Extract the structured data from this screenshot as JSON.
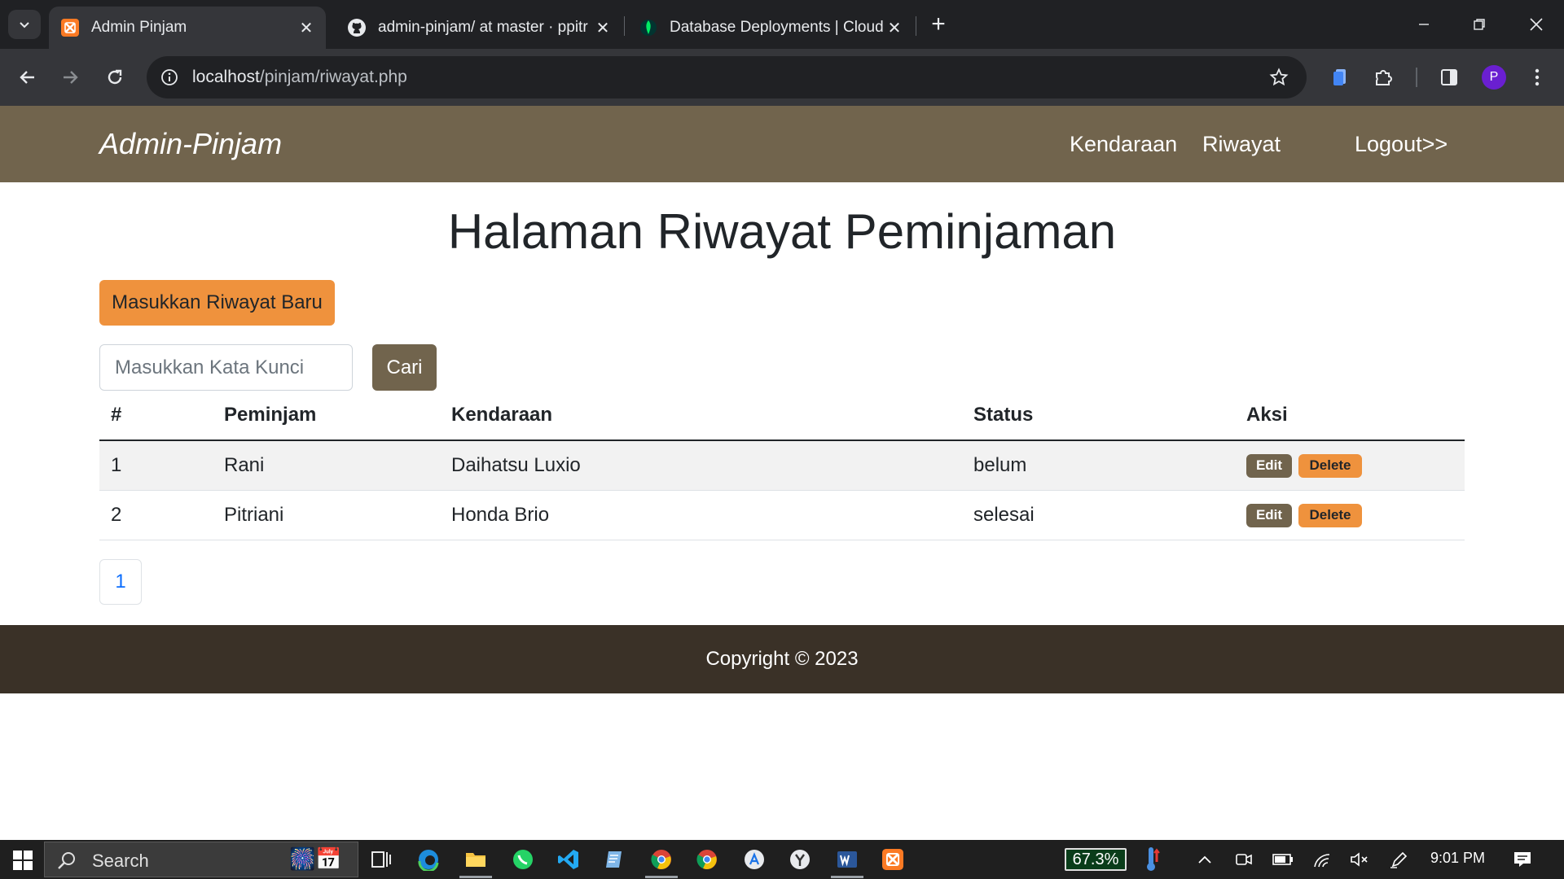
{
  "browser": {
    "tabs": [
      {
        "title": "Admin Pinjam",
        "active": true,
        "icon": "xampp-icon"
      },
      {
        "title": "admin-pinjam/ at master · ppitr",
        "active": false,
        "icon": "github-icon"
      },
      {
        "title": "Database Deployments | Cloud:",
        "active": false,
        "icon": "mongodb-leaf-icon"
      }
    ],
    "url_host": "localhost",
    "url_path": "/pinjam/riwayat.php",
    "profile_initial": "P"
  },
  "navbar": {
    "brand": "Admin-Pinjam",
    "links": [
      "Kendaraan",
      "Riwayat"
    ],
    "logout": "Logout>>"
  },
  "page": {
    "heading": "Halaman Riwayat Peminjaman",
    "new_button": "Masukkan Riwayat Baru",
    "search_placeholder": "Masukkan Kata Kunci",
    "search_button": "Cari"
  },
  "table": {
    "headers": [
      "#",
      "Peminjam",
      "Kendaraan",
      "Status",
      "Aksi"
    ],
    "rows": [
      {
        "no": "1",
        "peminjam": "Rani",
        "kendaraan": "Daihatsu Luxio",
        "status": "belum",
        "edit": "Edit",
        "delete": "Delete"
      },
      {
        "no": "2",
        "peminjam": "Pitriani",
        "kendaraan": "Honda Brio",
        "status": "selesai",
        "edit": "Edit",
        "delete": "Delete"
      }
    ]
  },
  "pagination": {
    "current": "1"
  },
  "footer": {
    "text": "Copyright © 2023"
  },
  "taskbar": {
    "search_label": "Search",
    "battery_percent": "67.3%",
    "time": "9:01 PM"
  },
  "colors": {
    "brand_brown": "#71644d",
    "accent_orange": "#ef923d",
    "footer_dark": "#3a3127"
  }
}
